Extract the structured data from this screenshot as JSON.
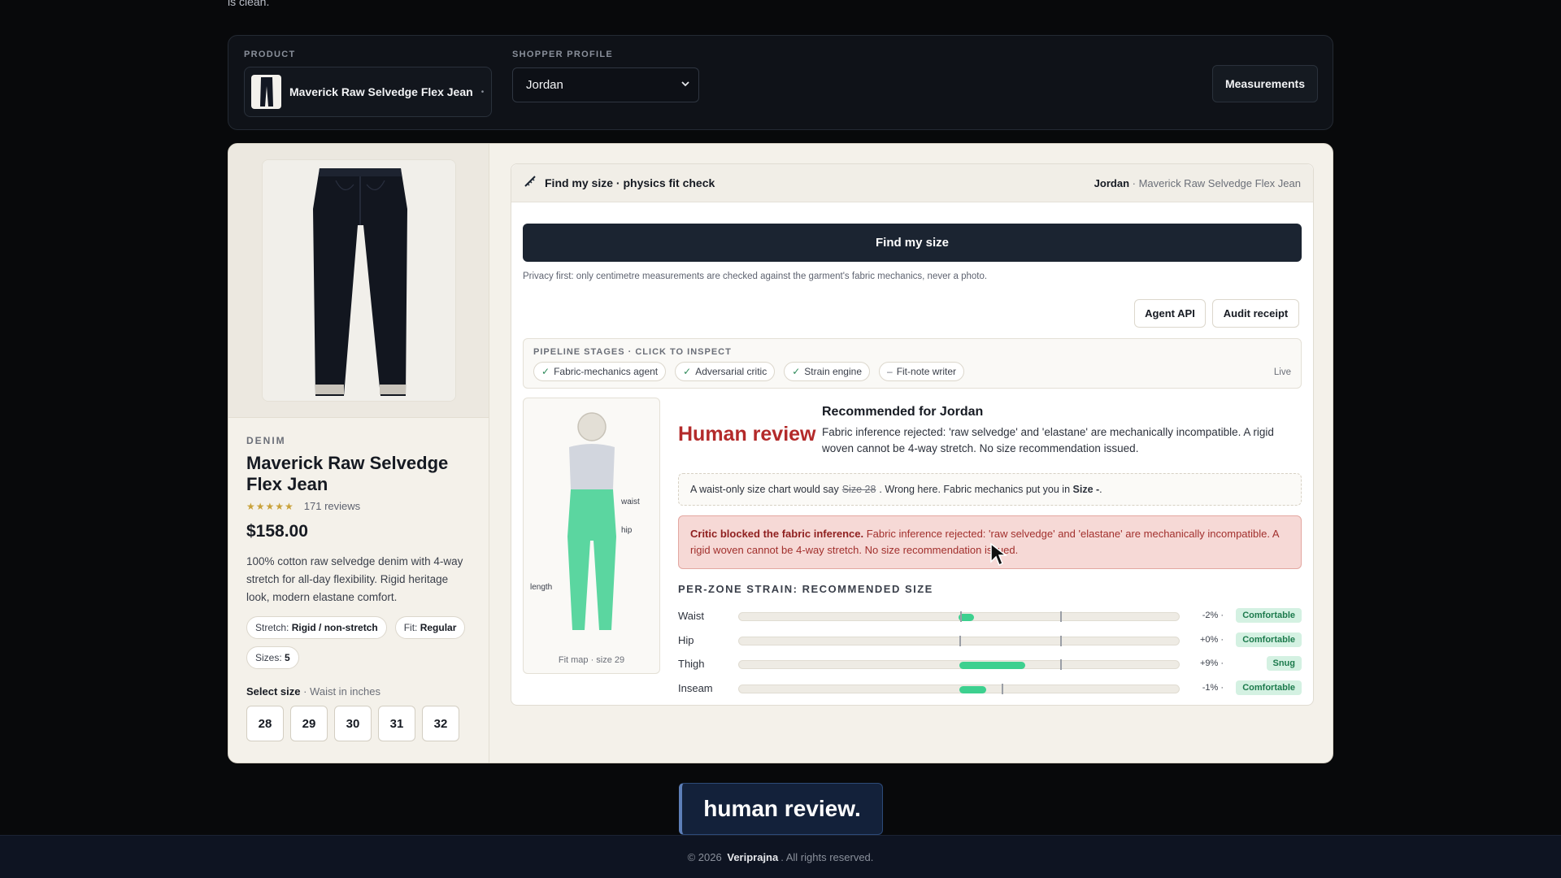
{
  "top_text": "is clean.",
  "selector": {
    "product_label": "PRODUCT",
    "product_name": "Maverick Raw Selvedge Flex Jean",
    "profile_label": "SHOPPER PROFILE",
    "profile_value": "Jordan",
    "measurements_label": "Measurements"
  },
  "product": {
    "category": "DENIM",
    "title": "Maverick Raw Selvedge Flex Jean",
    "rating": 4.5,
    "reviews": "171 reviews",
    "price": "$158.00",
    "description": "100% cotton raw selvedge denim with 4-way stretch for all-day flexibility. Rigid heritage look, modern elastane comfort.",
    "chips": [
      {
        "label": "Stretch:",
        "value": "Rigid / non-stretch"
      },
      {
        "label": "Fit:",
        "value": "Regular"
      },
      {
        "label": "Sizes:",
        "value": "5"
      }
    ],
    "select_size_label": "Select size",
    "select_size_hint": " · Waist in inches",
    "sizes": [
      "28",
      "29",
      "30",
      "31",
      "32"
    ]
  },
  "panel": {
    "title": "Find my size · physics fit check",
    "user": "Jordan",
    "user_product": " · Maverick Raw Selvedge Flex Jean",
    "find_button": "Find my size",
    "privacy": "Privacy first: only centimetre measurements are checked against the garment's fabric mechanics, never a photo.",
    "agent_api": "Agent API",
    "audit_receipt": "Audit receipt",
    "pipeline_label": "PIPELINE STAGES · CLICK TO INSPECT",
    "stages": [
      {
        "mark": "✓",
        "label": "Fabric-mechanics agent"
      },
      {
        "mark": "✓",
        "label": "Adversarial critic"
      },
      {
        "mark": "✓",
        "label": "Strain engine"
      },
      {
        "mark": "–",
        "label": "Fit-note writer"
      }
    ],
    "pipeline_status": "Live",
    "fitmap": {
      "waist": "waist",
      "hip": "hip",
      "length": "length",
      "caption": "Fit map · size 29"
    },
    "verdict": "Human review",
    "rec_title": "Recommended for Jordan",
    "rec_text": "Fabric inference rejected: 'raw selvedge' and 'elastane' are mechanically incompatible. A rigid woven cannot be 4-way stretch. No size recommendation issued.",
    "waist_note_pre": "A waist-only size chart would say",
    "waist_note_struck": "Size 28",
    "waist_note_mid": ". Wrong here. Fabric mechanics put you in",
    "waist_note_size": "Size -",
    "waist_note_end": ".",
    "critic_title": "Critic blocked the fabric inference.",
    "critic_text": " Fabric inference rejected: 'raw selvedge' and 'elastane' are mechanically incompatible. A rigid woven cannot be 4-way stretch. No size recommendation issued.",
    "strain_title": "PER-ZONE STRAIN: RECOMMENDED SIZE",
    "zones": [
      {
        "name": "Waist",
        "pct": "-2% ·",
        "status": "Comfortable"
      },
      {
        "name": "Hip",
        "pct": "+0% ·",
        "status": "Comfortable"
      },
      {
        "name": "Thigh",
        "pct": "+9% ·",
        "status": "Snug"
      },
      {
        "name": "Inseam",
        "pct": "-1% ·",
        "status": "Comfortable"
      }
    ]
  },
  "caption": "human review.",
  "footer": {
    "copyright": "© 2026",
    "brand": "Veriprajna",
    "rights": ". All rights reserved."
  },
  "colors": {
    "accent_dark": "#1b2431",
    "verdict_red": "#b32a2a",
    "strain_green": "#3dd08f"
  }
}
